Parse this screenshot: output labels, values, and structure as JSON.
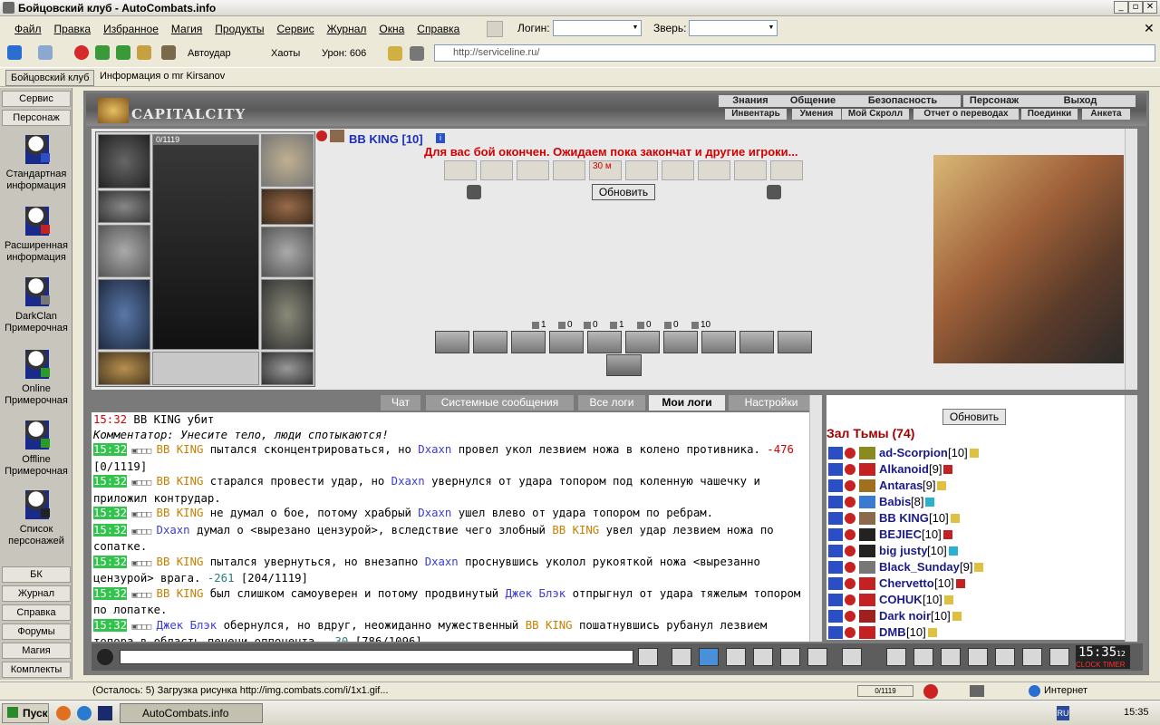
{
  "window": {
    "title": "Бойцовский клуб - AutoCombats.info"
  },
  "menu": [
    "Файл",
    "Правка",
    "Избранное",
    "Магия",
    "Продукты",
    "Сервис",
    "Журнал",
    "Окна",
    "Справка"
  ],
  "login_label": "Логин:",
  "beast_label": "Зверь:",
  "toolbar": {
    "autoudar": "Автоудар",
    "haoty": "Хаоты",
    "uron": "Урон: 606",
    "url": "http://serviceline.ru/"
  },
  "links": {
    "club": "Бойцовский клуб",
    "info": "Информация о mr Kirsanov"
  },
  "left": {
    "top": [
      "Сервис",
      "Персонаж"
    ],
    "items": [
      {
        "label": "Стандартная информация"
      },
      {
        "label": "Расширенная информация"
      },
      {
        "label": "DarkClan Примерочная"
      },
      {
        "label": "Online Примерочная"
      },
      {
        "label": "Offline Примерочная"
      },
      {
        "label": "Список персонажей"
      }
    ],
    "bottom": [
      "БК",
      "Журнал",
      "Справка",
      "Форумы",
      "Магия",
      "Комплекты"
    ]
  },
  "nav": {
    "top": [
      "Знания",
      "Общение",
      "Безопасность",
      "Персонаж",
      "Выход"
    ],
    "bottom": [
      "Инвентарь",
      "Умения",
      "Мой Скролл",
      "Отчет о переводах",
      "Поединки",
      "Анкета"
    ]
  },
  "logo": "CAPITALCITY",
  "char": {
    "hp": "0/1119",
    "name": "BB KING [10]"
  },
  "battle": {
    "message": "Для вас бой окончен. Ожидаем пока закончат и другие игроки...",
    "timer": "30 м",
    "refresh": "Обновить"
  },
  "counters": [
    "1",
    "0",
    "0",
    "1",
    "0",
    "0",
    "10"
  ],
  "tabs": [
    "Чат",
    "Системные сообщения",
    "Все логи",
    "Мои логи",
    "Настройки"
  ],
  "log": [
    {
      "time": "15:32",
      "text": " BB KING убит"
    },
    {
      "text": "Комментатор: Унесите тело, люди спотыкаются!"
    },
    {
      "time": "15:32",
      "a": "BB KING",
      "t1": " пытался сконцентрироваться, но ",
      "b": "Dxaxn",
      "t2": " провел укол лезвием ножа в колено противника. ",
      "dmg": "-476",
      "hp": " [0/1119]"
    },
    {
      "time": "15:32",
      "a": "BB KING",
      "t1": " старался провести удар, но ",
      "b": "Dxaxn",
      "t2": " увернулся от удара топором под коленную чашечку и приложил контрудар."
    },
    {
      "time": "15:32",
      "a": "BB KING",
      "t1": " не думал о бое, потому храбрый ",
      "b": "Dxaxn",
      "t2": " ушел влево от удара топором по ребрам."
    },
    {
      "time": "15:32",
      "a": "Dxaxn",
      "t1": " думал о <вырезано цензурой>, вследствие чего злобный ",
      "b": "BB KING",
      "t2": " увел удар лезвием ножа по сопатке."
    },
    {
      "time": "15:32",
      "a": "BB KING",
      "t1": " пытался увернуться, но внезапно ",
      "b": "Dxaxn",
      "t2": " проснувшись уколол рукояткой ножа <вырезанно цензурой> врага. ",
      "dmg": "-261",
      "hp": " [204/1119]"
    },
    {
      "time": "15:32",
      "a": "BB KING",
      "t1": " был слишком самоуверен и потому продвинутый ",
      "b": "Джек Блэк",
      "t2": " отпрыгнул от удара тяжелым топором по лопатке."
    },
    {
      "time": "15:32",
      "a": "Джек Блэк",
      "t1": " обернулся, но вдруг, неожиданно мужественный ",
      "b": "BB KING",
      "t2": " пошатнувшись рубанул лезвием топора в область печени оппонента. ",
      "dmg": "-30",
      "hp": " [786/1096]"
    }
  ],
  "room": {
    "refresh": "Обновить",
    "title": "Зал Тьмы (74)",
    "players": [
      {
        "name": "ad-Scorpion",
        "lvl": "[10]"
      },
      {
        "name": "Alkanoid",
        "lvl": "[9]"
      },
      {
        "name": "Antaras",
        "lvl": "[9]"
      },
      {
        "name": "Babis",
        "lvl": "[8]"
      },
      {
        "name": "BB KING",
        "lvl": "[10]"
      },
      {
        "name": "BEJIEC",
        "lvl": "[10]"
      },
      {
        "name": "big justy",
        "lvl": "[10]"
      },
      {
        "name": "Black_Sunday",
        "lvl": "[9]"
      },
      {
        "name": "Chervetto",
        "lvl": "[10]"
      },
      {
        "name": "COHUK",
        "lvl": "[10]"
      },
      {
        "name": "Dark noir",
        "lvl": "[10]"
      },
      {
        "name": "DMB",
        "lvl": "[10]"
      }
    ]
  },
  "clock": {
    "time": "15:35",
    "small": "12",
    "clock": "CLOCK",
    "timer": "TIMER"
  },
  "status": {
    "text": "(Осталось: 5) Загрузка рисунка http://img.combats.com/i/1x1.gif...",
    "hp": "0/1119",
    "zone": "Интернет"
  },
  "taskbar": {
    "start": "Пуск",
    "app": "AutoCombats.info",
    "time": "15:35"
  },
  "colors": {
    "timestamp": "#31c34c",
    "attacker": "#c58000",
    "defender": "#3c3cd6",
    "damage": "#d40000"
  }
}
